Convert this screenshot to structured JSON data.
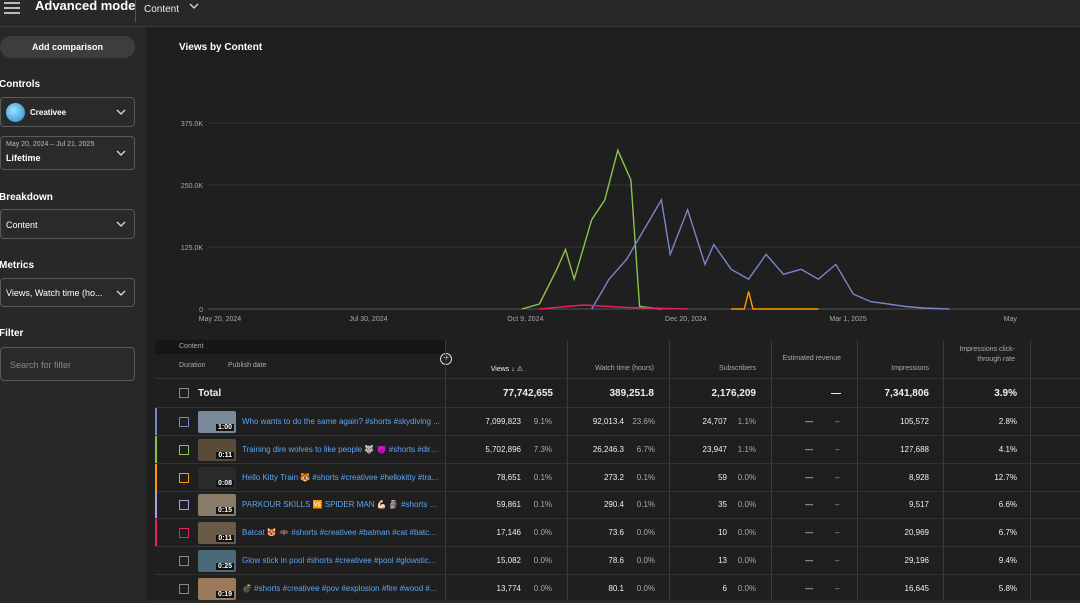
{
  "header": {
    "title": "Advanced mode",
    "content_label": "Content"
  },
  "sidebar": {
    "add_comparison": "Add comparison",
    "controls_label": "Controls",
    "channel": "Creativee",
    "date_range": "May 20, 2024 – Jul 21, 2025",
    "date_preset": "Lifetime",
    "breakdown_label": "Breakdown",
    "breakdown_value": "Content",
    "metrics_label": "Metrics",
    "metrics_value": "Views, Watch time (ho...",
    "filter_label": "Filter",
    "filter_placeholder": "Search for filter"
  },
  "chart": {
    "title": "Views by Content"
  },
  "chart_data": {
    "type": "line",
    "title": "Views by Content",
    "y_ticks": [
      "375.0K",
      "250.0K",
      "125.0K",
      "0"
    ],
    "x_ticks": [
      "May 20, 2024",
      "Jul 30, 2024",
      "Oct 9, 2024",
      "Dec 20, 2024",
      "Mar 1, 2025",
      "May"
    ],
    "ylim": [
      0,
      375000
    ],
    "series": [
      {
        "color": "#8bc34a",
        "values": [
          [
            0.36,
            0
          ],
          [
            0.38,
            10000
          ],
          [
            0.4,
            80000
          ],
          [
            0.41,
            120000
          ],
          [
            0.42,
            60000
          ],
          [
            0.44,
            180000
          ],
          [
            0.455,
            220000
          ],
          [
            0.47,
            320000
          ],
          [
            0.485,
            260000
          ],
          [
            0.49,
            130000
          ],
          [
            0.495,
            5000
          ],
          [
            0.52,
            0
          ]
        ]
      },
      {
        "color": "#7986cb",
        "values": [
          [
            0.44,
            0
          ],
          [
            0.46,
            60000
          ],
          [
            0.48,
            100000
          ],
          [
            0.5,
            160000
          ],
          [
            0.52,
            220000
          ],
          [
            0.53,
            110000
          ],
          [
            0.55,
            200000
          ],
          [
            0.57,
            90000
          ],
          [
            0.58,
            130000
          ],
          [
            0.6,
            80000
          ],
          [
            0.62,
            60000
          ],
          [
            0.64,
            110000
          ],
          [
            0.66,
            70000
          ],
          [
            0.68,
            80000
          ],
          [
            0.7,
            60000
          ],
          [
            0.72,
            90000
          ],
          [
            0.74,
            30000
          ],
          [
            0.76,
            15000
          ],
          [
            0.78,
            10000
          ],
          [
            0.8,
            5000
          ],
          [
            0.82,
            2000
          ],
          [
            0.85,
            0
          ]
        ]
      },
      {
        "color": "#ff9800",
        "values": [
          [
            0.6,
            0
          ],
          [
            0.615,
            0
          ],
          [
            0.62,
            35000
          ],
          [
            0.625,
            0
          ],
          [
            0.7,
            0
          ]
        ]
      },
      {
        "color": "#e91e63",
        "values": [
          [
            0.38,
            0
          ],
          [
            0.43,
            8000
          ],
          [
            0.48,
            3000
          ],
          [
            0.55,
            0
          ]
        ]
      }
    ]
  },
  "table": {
    "col_content": "Content",
    "col_duration": "Duration",
    "col_publish": "Publish date",
    "col_views": "Views",
    "col_watch": "Watch time (hours)",
    "col_subs": "Subscribers",
    "col_revenue": "Estimated revenue",
    "col_impr": "Impressions",
    "col_ctr": "Impressions click-through rate",
    "total_label": "Total",
    "totals": {
      "views": "77,742,655",
      "watch": "389,251.8",
      "subs": "2,176,209",
      "revenue": "—",
      "impr": "7,341,806",
      "ctr": "3.9%"
    },
    "rows": [
      {
        "color": "#7986cb",
        "dur": "1:00",
        "title": "Who wants to do the same again? #shorts #skydiving ...",
        "views": "7,099,823",
        "vp": "9.1%",
        "watch": "92,013.4",
        "wp": "23.6%",
        "subs": "24,707",
        "sp": "1.1%",
        "rev": "—",
        "revp": "–",
        "impr": "105,572",
        "ctr": "2.8%"
      },
      {
        "color": "#8bc34a",
        "dur": "0:11",
        "title": "Training dire wolves to like people 🐺 😈 #shorts #dire...",
        "views": "5,702,896",
        "vp": "7.3%",
        "watch": "26,246.3",
        "wp": "6.7%",
        "subs": "23,947",
        "sp": "1.1%",
        "rev": "—",
        "revp": "–",
        "impr": "127,688",
        "ctr": "4.1%"
      },
      {
        "color": "#ff9800",
        "dur": "0:08",
        "title": "Hello Kitty Train 🐯 #shorts #creativee #hellokitty #tra...",
        "views": "78,651",
        "vp": "0.1%",
        "watch": "273.2",
        "wp": "0.1%",
        "subs": "59",
        "sp": "0.0%",
        "rev": "—",
        "revp": "–",
        "impr": "8,928",
        "ctr": "12.7%"
      },
      {
        "color": "#b39ddb",
        "dur": "0:15",
        "title": "PARKOUR SKILLS 🆚 SPIDER MAN 💪🏻 🗿 #shorts #cr...",
        "views": "59,861",
        "vp": "0.1%",
        "watch": "290.4",
        "wp": "0.1%",
        "subs": "35",
        "sp": "0.0%",
        "rev": "—",
        "revp": "–",
        "impr": "9,517",
        "ctr": "6.6%"
      },
      {
        "color": "#e91e63",
        "dur": "0:11",
        "title": "Batcat 😻 🦇 #shorts #creativee #batman #cat #batca...",
        "views": "17,146",
        "vp": "0.0%",
        "watch": "73.6",
        "wp": "0.0%",
        "subs": "10",
        "sp": "0.0%",
        "rev": "—",
        "revp": "–",
        "impr": "20,969",
        "ctr": "6.7%"
      },
      {
        "color": "",
        "dur": "0:25",
        "title": "Glow stick in pool #shorts #creativee #pool #glowstic...",
        "views": "15,082",
        "vp": "0.0%",
        "watch": "78.6",
        "wp": "0.0%",
        "subs": "13",
        "sp": "0.0%",
        "rev": "—",
        "revp": "–",
        "impr": "29,196",
        "ctr": "9.4%"
      },
      {
        "color": "",
        "dur": "0:19",
        "title": "💣 #shorts #creativee #pov #explosion #fire #wood #...",
        "views": "13,774",
        "vp": "0.0%",
        "watch": "80.1",
        "wp": "0.0%",
        "subs": "6",
        "sp": "0.0%",
        "rev": "—",
        "revp": "–",
        "impr": "16,645",
        "ctr": "5.8%"
      }
    ]
  }
}
